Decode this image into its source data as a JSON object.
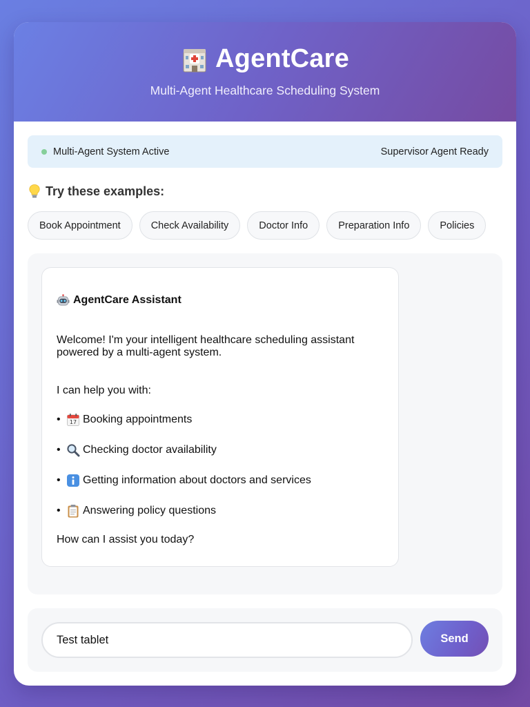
{
  "header": {
    "app_title": "AgentCare",
    "subtitle": "Multi-Agent Healthcare Scheduling System",
    "logo_icon": "hospital-icon"
  },
  "status": {
    "left_text": "Multi-Agent System Active",
    "right_text": "Supervisor Agent Ready",
    "dot_color": "#86cf9a"
  },
  "examples": {
    "title": "Try these examples:",
    "title_icon": "lightbulb-icon",
    "chips": [
      "Book Appointment",
      "Check Availability",
      "Doctor Info",
      "Preparation Info",
      "Policies"
    ]
  },
  "chat": {
    "messages": [
      {
        "sender": "AgentCare Assistant",
        "sender_icon": "robot-icon",
        "intro": "Welcome! I'm your intelligent healthcare scheduling assistant powered by a multi-agent system.",
        "help_heading": "I can help you with:",
        "items": [
          {
            "icon": "calendar-icon",
            "text": "Booking appointments"
          },
          {
            "icon": "magnifier-icon",
            "text": "Checking doctor availability"
          },
          {
            "icon": "info-icon",
            "text": "Getting information about doctors and services"
          },
          {
            "icon": "clipboard-icon",
            "text": "Answering policy questions"
          }
        ],
        "outro": "How can I assist you today?"
      }
    ]
  },
  "composer": {
    "input_value": "Test tablet",
    "send_label": "Send"
  },
  "colors": {
    "accent_start": "#667eea",
    "accent_end": "#764ba2"
  }
}
